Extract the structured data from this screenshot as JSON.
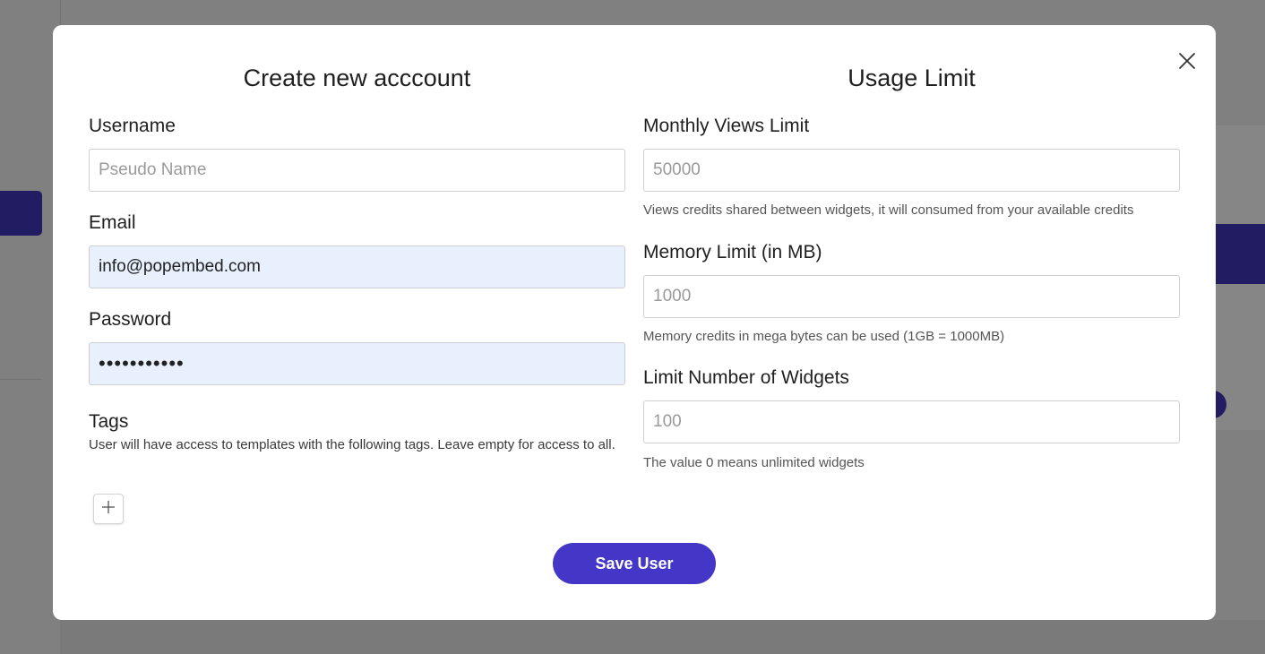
{
  "colors": {
    "overlay": "#808080",
    "primary": "#4437c8",
    "dark_accent": "#221d63",
    "autofill_bg": "#e8f0fe"
  },
  "modal": {
    "close_icon": "close-icon",
    "left": {
      "title": "Create new acccount",
      "username": {
        "label": "Username",
        "placeholder": "Pseudo Name",
        "value": ""
      },
      "email": {
        "label": "Email",
        "value": "info@popembed.com"
      },
      "password": {
        "label": "Password",
        "value": "•••••••••••"
      },
      "tags": {
        "label": "Tags",
        "description": "User will have access to templates with the following tags. Leave empty for access to all.",
        "add_icon": "plus-icon"
      }
    },
    "right": {
      "title": "Usage Limit",
      "monthly_views": {
        "label": "Monthly Views Limit",
        "placeholder": "50000",
        "helper": "Views credits shared between widgets, it will consumed from your available credits"
      },
      "memory": {
        "label": "Memory Limit (in MB)",
        "placeholder": "1000",
        "helper": "Memory credits in mega bytes can be used (1GB = 1000MB)"
      },
      "widgets": {
        "label": "Limit Number of Widgets",
        "placeholder": "100",
        "helper": "The value 0 means unlimited widgets"
      }
    },
    "save_label": "Save User"
  }
}
